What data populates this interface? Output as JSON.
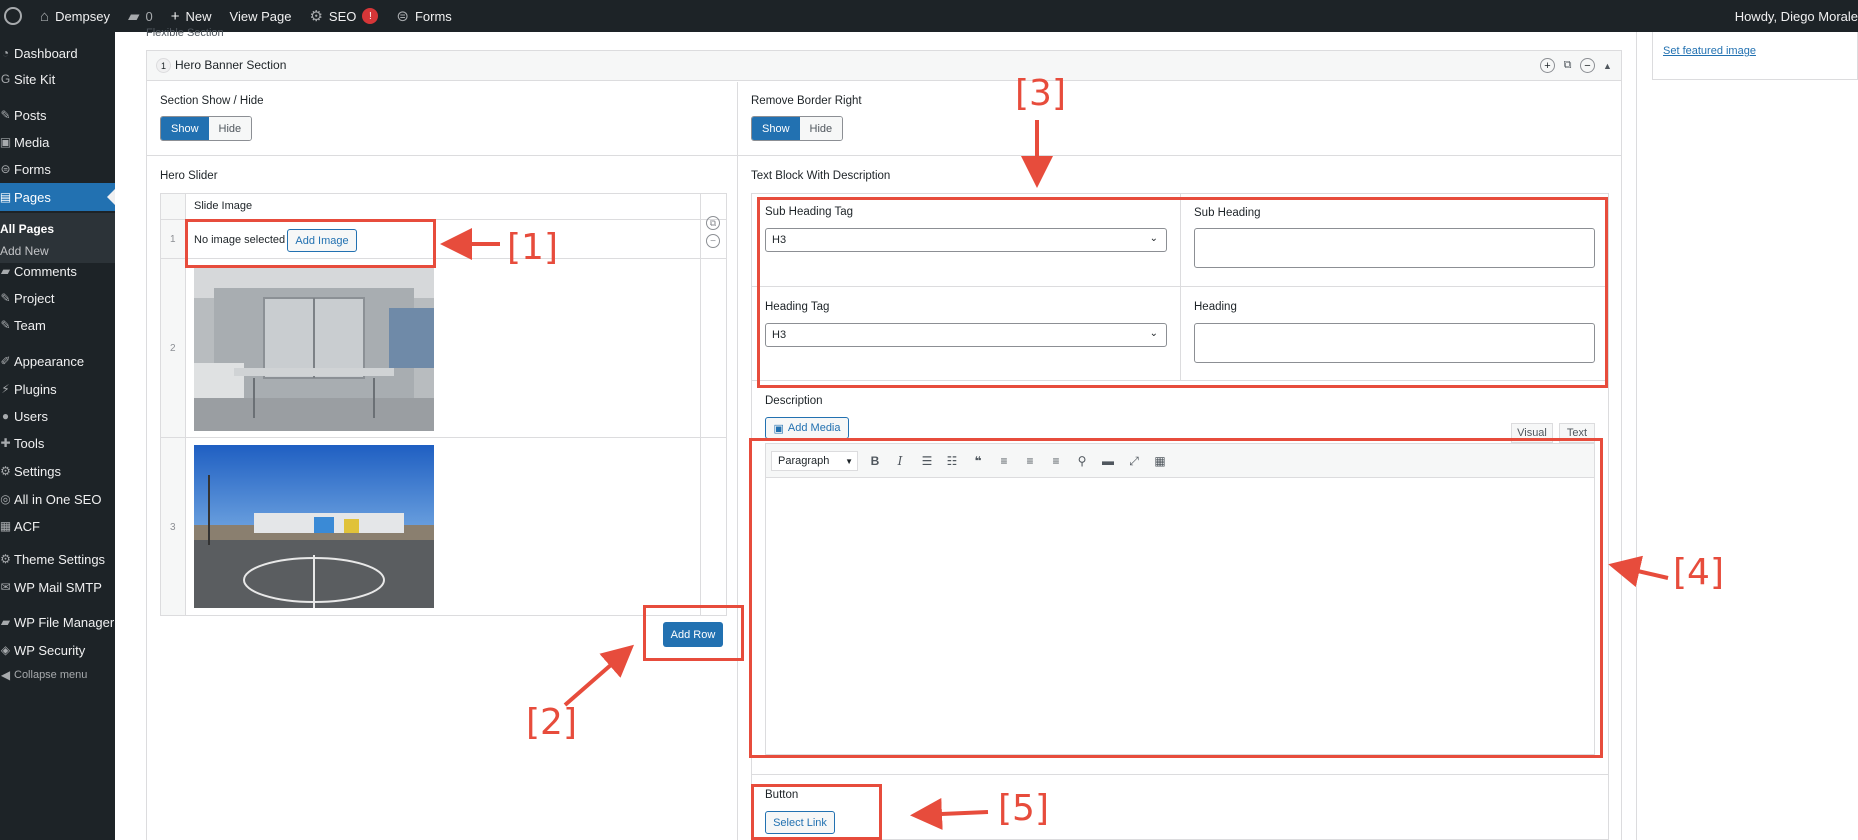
{
  "admin_bar": {
    "site_name": "Dempsey",
    "comments_count": "0",
    "new_label": "New",
    "view_page_label": "View Page",
    "seo_label": "SEO",
    "seo_badge": "!",
    "forms_label": "Forms",
    "howdy": "Howdy, Diego Morale"
  },
  "sidebar": {
    "items": [
      {
        "label": "Dashboard",
        "icon": "dashboard-icon"
      },
      {
        "label": "Site Kit",
        "icon": "sitekit-icon"
      },
      {
        "label": "Posts",
        "icon": "pin-icon"
      },
      {
        "label": "Media",
        "icon": "media-icon"
      },
      {
        "label": "Forms",
        "icon": "forms-icon"
      },
      {
        "label": "Pages",
        "icon": "pages-icon"
      },
      {
        "label": "Comments",
        "icon": "comments-icon"
      },
      {
        "label": "Project",
        "icon": "pin-icon"
      },
      {
        "label": "Team",
        "icon": "pin-icon"
      },
      {
        "label": "Appearance",
        "icon": "appearance-icon"
      },
      {
        "label": "Plugins",
        "icon": "plugins-icon"
      },
      {
        "label": "Users",
        "icon": "users-icon"
      },
      {
        "label": "Tools",
        "icon": "tools-icon"
      },
      {
        "label": "Settings",
        "icon": "settings-icon"
      },
      {
        "label": "All in One SEO",
        "icon": "seo-icon"
      },
      {
        "label": "ACF",
        "icon": "acf-icon"
      },
      {
        "label": "Theme Settings",
        "icon": "gear-icon"
      },
      {
        "label": "WP Mail SMTP",
        "icon": "mail-icon"
      },
      {
        "label": "WP File Manager",
        "icon": "folder-icon"
      },
      {
        "label": "WP Security",
        "icon": "shield-icon"
      },
      {
        "label": "Collapse menu",
        "icon": "collapse-icon"
      }
    ],
    "submenu": [
      "All Pages",
      "Add New"
    ]
  },
  "editor": {
    "flexible_section_label": "Flexible Section",
    "layout_index": "1",
    "layout_title": "Hero Banner Section",
    "set_featured_image": "Set featured image",
    "section_show_hide_label": "Section Show / Hide",
    "remove_border_label": "Remove Border Right",
    "show_label": "Show",
    "hide_label": "Hide",
    "hero_slider_label": "Hero Slider",
    "slide_image_header": "Slide Image",
    "rows": [
      "1",
      "2",
      "3"
    ],
    "no_image_text": "No image selected",
    "add_image_label": "Add Image",
    "add_row_label": "Add Row",
    "text_block_label": "Text Block With Description",
    "sub_heading_tag_label": "Sub Heading Tag",
    "sub_heading_tag_value": "H3",
    "sub_heading_label": "Sub Heading",
    "heading_tag_label": "Heading Tag",
    "heading_tag_value": "H3",
    "heading_label": "Heading",
    "description_label": "Description",
    "add_media_label": "Add Media",
    "visual_tab": "Visual",
    "text_tab": "Text",
    "format_select": "Paragraph",
    "button_label": "Button",
    "select_link_label": "Select Link"
  },
  "annotations": [
    "[1]",
    "[2]",
    "[3]",
    "[4]",
    "[5]"
  ],
  "colors": {
    "admin_dark": "#1d2327",
    "wp_blue": "#2271b1",
    "annotation_red": "#e74c3c"
  }
}
